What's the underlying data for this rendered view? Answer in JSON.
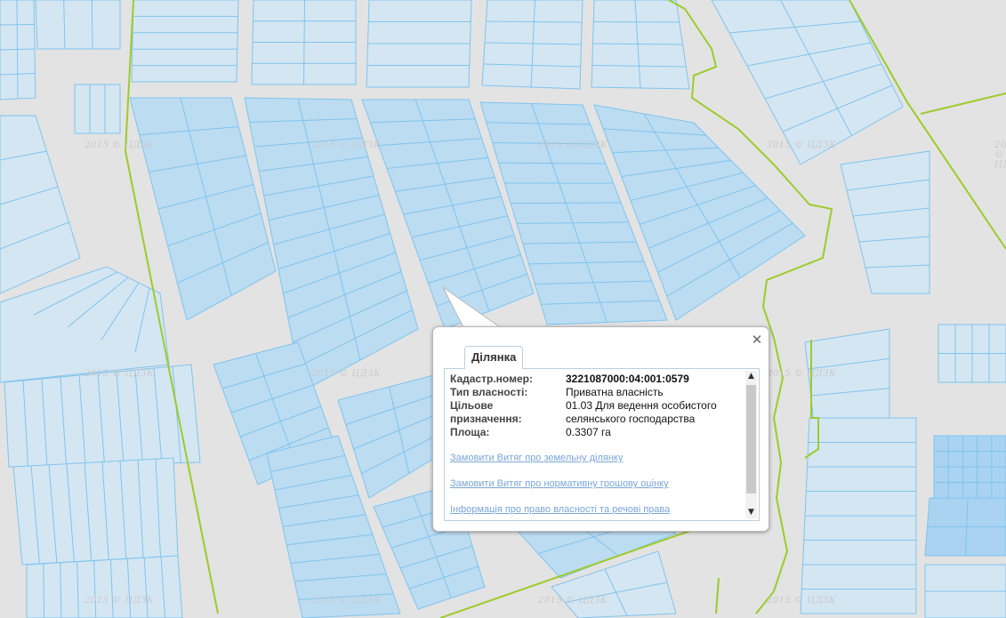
{
  "map": {
    "watermark": "2015 © ЦДЗК",
    "colors": {
      "background": "#e3e3e3",
      "parcel_fill": "#bcdcf2",
      "parcel_fill_strong": "#a9d3f1",
      "parcel_stroke": "#7fc4ee",
      "boundary": "#9ccc2a"
    }
  },
  "popup": {
    "tab_label": "Ділянка",
    "close_icon": "✕",
    "fields": [
      {
        "key": "Кадастр.номер:",
        "value": "3221087000:04:001:0579"
      },
      {
        "key": "Тип власності:",
        "value": "Приватна власність"
      },
      {
        "key": "Цільове призначення:",
        "value": "01.03 Для ведення особистого селянського господарства"
      },
      {
        "key": "Площа:",
        "value": "0.3307 га"
      }
    ],
    "links": [
      "Замовити Витяг про земельну ділянку",
      "Замовити Витяг про нормативну грошову оцінку",
      "Інформація про право власності та речові права"
    ],
    "scroll_up_icon": "▲",
    "scroll_down_icon": "▼"
  }
}
